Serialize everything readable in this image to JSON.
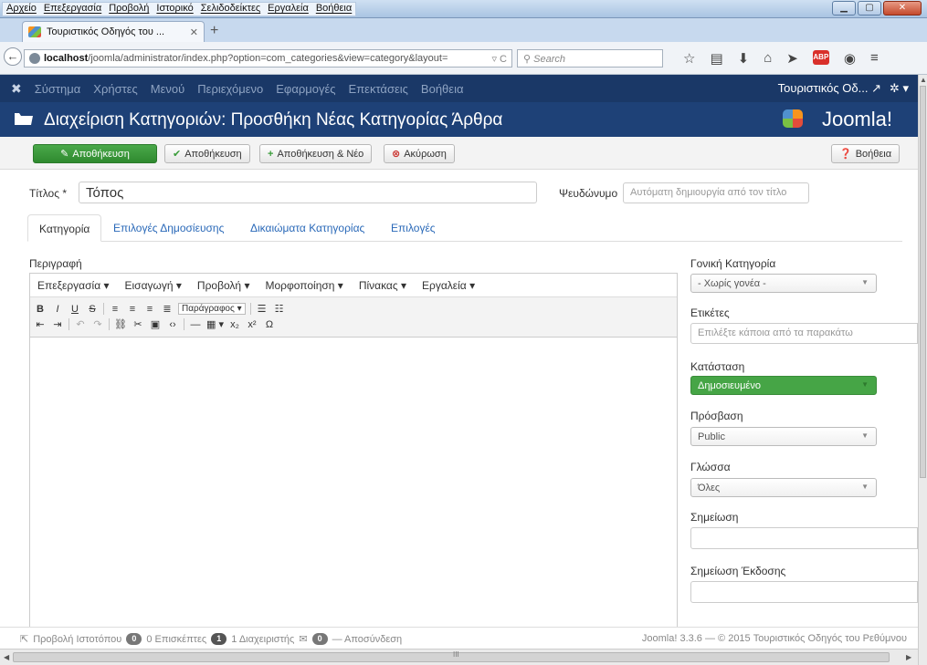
{
  "browser": {
    "menu": [
      "Αρχείο",
      "Επεξεργασία",
      "Προβολή",
      "Ιστορικό",
      "Σελιδοδείκτες",
      "Εργαλεία",
      "Βοήθεια"
    ],
    "tab_title": "Τουριστικός Οδηγός του ...",
    "url_host": "localhost",
    "url_path": "/joomla/administrator/index.php?option=com_categories&view=category&layout=",
    "search_placeholder": "Search"
  },
  "admin_menu": {
    "items": [
      "Σύστημα",
      "Χρήστες",
      "Μενού",
      "Περιεχόμενο",
      "Εφαρμογές",
      "Επεκτάσεις",
      "Βοήθεια"
    ],
    "site_name": "Τουριστικός Οδ..."
  },
  "header": {
    "title": "Διαχείριση Κατηγοριών: Προσθήκη Νέας Κατηγορίας Άρθρα",
    "brand": "Joomla!"
  },
  "toolbar": {
    "save": "Αποθήκευση",
    "save_close": "Αποθήκευση",
    "save_new": "Αποθήκευση & Νέο",
    "cancel": "Ακύρωση",
    "help": "Βοήθεια"
  },
  "form": {
    "title_label": "Τίτλος *",
    "title_value": "Τόπος",
    "alias_label": "Ψευδώνυμο",
    "alias_placeholder": "Αυτόματη δημιουργία από τον τίτλο",
    "tabs": [
      "Κατηγορία",
      "Επιλογές Δημοσίευσης",
      "Δικαιώματα Κατηγορίας",
      "Επιλογές"
    ],
    "description_label": "Περιγραφή"
  },
  "editor": {
    "menus": [
      "Επεξεργασία ▾",
      "Εισαγωγή ▾",
      "Προβολή ▾",
      "Μορφοποίηση ▾",
      "Πίνακας ▾",
      "Εργαλεία ▾"
    ],
    "format_dropdown": "Παράγραφος ▾"
  },
  "sidebar": {
    "parent_label": "Γονική Κατηγορία",
    "parent_value": "- Χωρίς γονέα -",
    "tags_label": "Ετικέτες",
    "tags_placeholder": "Επιλέξτε κάποια από τα παρακάτω",
    "status_label": "Κατάσταση",
    "status_value": "Δημοσιευμένο",
    "access_label": "Πρόσβαση",
    "access_value": "Public",
    "language_label": "Γλώσσα",
    "language_value": "Όλες",
    "note_label": "Σημείωση",
    "version_note_label": "Σημείωση Έκδοσης"
  },
  "status_bar": {
    "view_site": "Προβολή Ιστοτόπου",
    "visitors_count": "0",
    "visitors": "0 Επισκέπτες",
    "admins_count": "1",
    "admins": "1 Διαχειριστής",
    "messages_count": "0",
    "logout": "— Αποσύνδεση",
    "version": "Joomla! 3.3.6 — © 2015 Τουριστικός Οδηγός του Ρεθύμνου"
  }
}
